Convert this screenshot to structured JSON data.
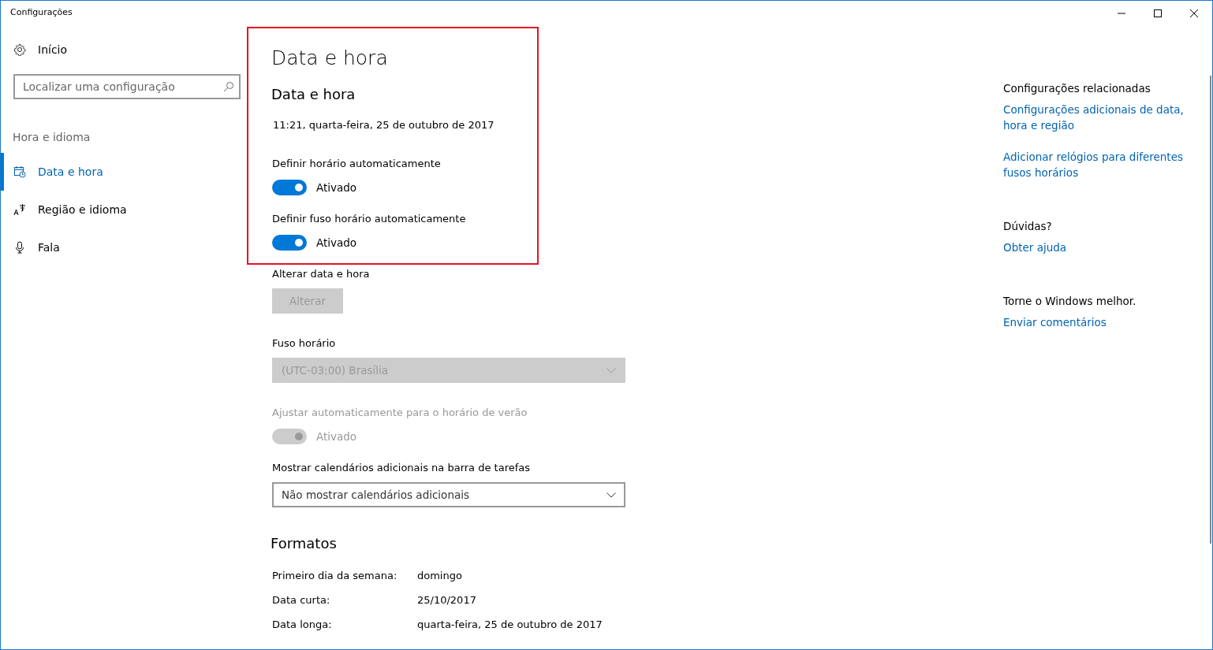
{
  "window": {
    "title": "Configurações"
  },
  "sidebar": {
    "home": {
      "label": "Início"
    },
    "search": {
      "placeholder": "Localizar uma configuração"
    },
    "section_label": "Hora e idioma",
    "items": [
      {
        "label": "Data e hora",
        "selected": true
      },
      {
        "label": "Região e idioma",
        "selected": false
      },
      {
        "label": "Fala",
        "selected": false
      }
    ]
  },
  "main": {
    "title": "Data e hora",
    "section_title": "Data e hora",
    "current_datetime": "11:21, quarta-feira, 25 de outubro de 2017",
    "settings": [
      {
        "kind": "toggle",
        "label": "Definir horário automaticamente",
        "on": true,
        "disabled": false,
        "state_text": "Ativado"
      },
      {
        "kind": "toggle",
        "label": "Definir fuso horário automaticamente",
        "on": true,
        "disabled": false,
        "state_text": "Ativado"
      },
      {
        "kind": "button",
        "label": "Alterar data e hora",
        "button_label": "Alterar",
        "disabled": true
      },
      {
        "kind": "dropdown",
        "label": "Fuso horário",
        "value": "(UTC-03:00) Brasília",
        "disabled": true
      },
      {
        "kind": "toggle",
        "label": "Ajustar automaticamente para o horário de verão",
        "on": true,
        "disabled": true,
        "state_text": "Ativado"
      },
      {
        "kind": "dropdown",
        "label": "Mostrar calendários adicionais na barra de tarefas",
        "value": "Não mostrar calendários adicionais",
        "disabled": false
      }
    ],
    "formats": {
      "title": "Formatos",
      "rows": [
        {
          "label": "Primeiro dia da semana:",
          "value": "domingo"
        },
        {
          "label": "Data curta:",
          "value": "25/10/2017"
        },
        {
          "label": "Data longa:",
          "value": "quarta-feira, 25 de outubro de 2017"
        }
      ]
    }
  },
  "related": [
    {
      "heading": "Configurações relacionadas",
      "links": [
        "Configurações adicionais de data, hora e região",
        "Adicionar relógios para diferentes fusos horários"
      ]
    },
    {
      "heading": "Dúvidas?",
      "links": [
        "Obter ajuda"
      ]
    },
    {
      "heading": "Torne o Windows melhor.",
      "links": [
        "Enviar comentários"
      ]
    }
  ]
}
